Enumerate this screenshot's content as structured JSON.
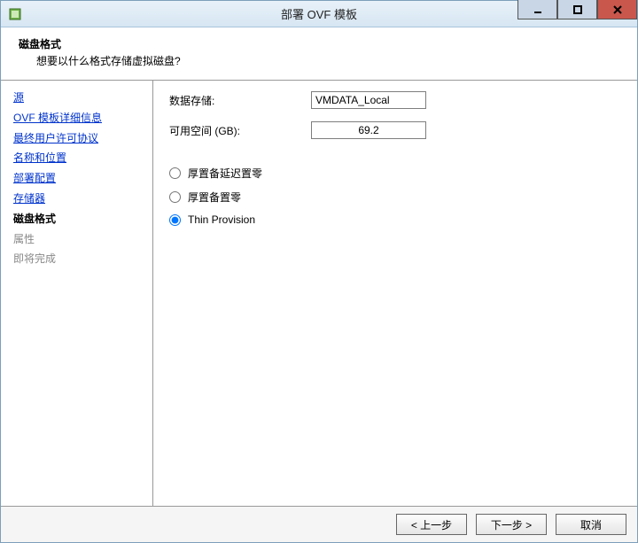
{
  "window": {
    "title": "部署 OVF 模板"
  },
  "header": {
    "title": "磁盘格式",
    "subtitle": "想要以什么格式存储虚拟磁盘?"
  },
  "sidebar": {
    "steps": [
      {
        "label": "源",
        "state": "link"
      },
      {
        "label": "OVF 模板详细信息",
        "state": "link"
      },
      {
        "label": "最终用户许可协议",
        "state": "link"
      },
      {
        "label": "名称和位置",
        "state": "link"
      },
      {
        "label": "部署配置",
        "state": "link"
      },
      {
        "label": "存储器",
        "state": "link"
      },
      {
        "label": "磁盘格式",
        "state": "current"
      },
      {
        "label": "属性",
        "state": "disabled"
      },
      {
        "label": "即将完成",
        "state": "disabled"
      }
    ]
  },
  "content": {
    "datastore_label": "数据存储:",
    "datastore_value": "VMDATA_Local",
    "avail_label": "可用空间 (GB):",
    "avail_value": "69.2",
    "provision": {
      "options": [
        {
          "label": "厚置备延迟置零",
          "value": "thick_lazy",
          "selected": false
        },
        {
          "label": "厚置备置零",
          "value": "thick_eager",
          "selected": false
        },
        {
          "label": "Thin Provision",
          "value": "thin",
          "selected": true
        }
      ]
    }
  },
  "footer": {
    "back": "< 上一步",
    "next": "下一步 >",
    "cancel": "取消"
  }
}
